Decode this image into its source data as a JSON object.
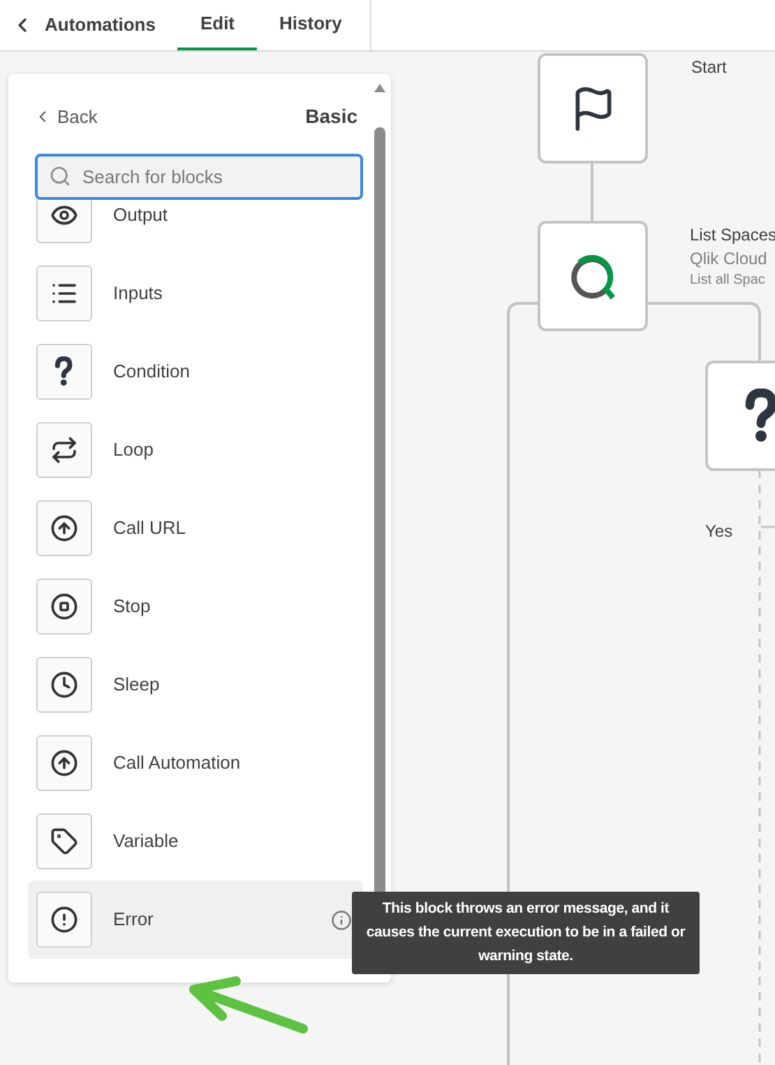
{
  "header": {
    "back_label": "Automations",
    "tabs": [
      {
        "label": "Edit",
        "selected": true
      },
      {
        "label": "History",
        "selected": false
      }
    ]
  },
  "panel": {
    "back": "Back",
    "title": "Basic",
    "search": {
      "placeholder": "Search for blocks"
    },
    "items": [
      {
        "label": "Output",
        "selected": false
      },
      {
        "label": "Inputs",
        "selected": false
      },
      {
        "label": "Condition",
        "selected": false
      },
      {
        "label": "Loop",
        "selected": false
      },
      {
        "label": "Call URL",
        "selected": false
      },
      {
        "label": "Stop",
        "selected": false
      },
      {
        "label": "Sleep",
        "selected": false
      },
      {
        "label": "Call Automation",
        "selected": false
      },
      {
        "label": "Variable",
        "selected": false
      },
      {
        "label": "Error",
        "selected": true
      }
    ],
    "tooltip": "This block throws an error message, and it causes the current execution to be in a failed or warning state."
  },
  "canvas": {
    "nodes": [
      {
        "kind": "start",
        "lines": [
          "Start"
        ]
      },
      {
        "kind": "qlik",
        "lines": [
          "List Spaces",
          "Qlik Cloud",
          "List all Spac"
        ]
      },
      {
        "kind": "condition"
      }
    ],
    "branch_label": "Yes"
  }
}
